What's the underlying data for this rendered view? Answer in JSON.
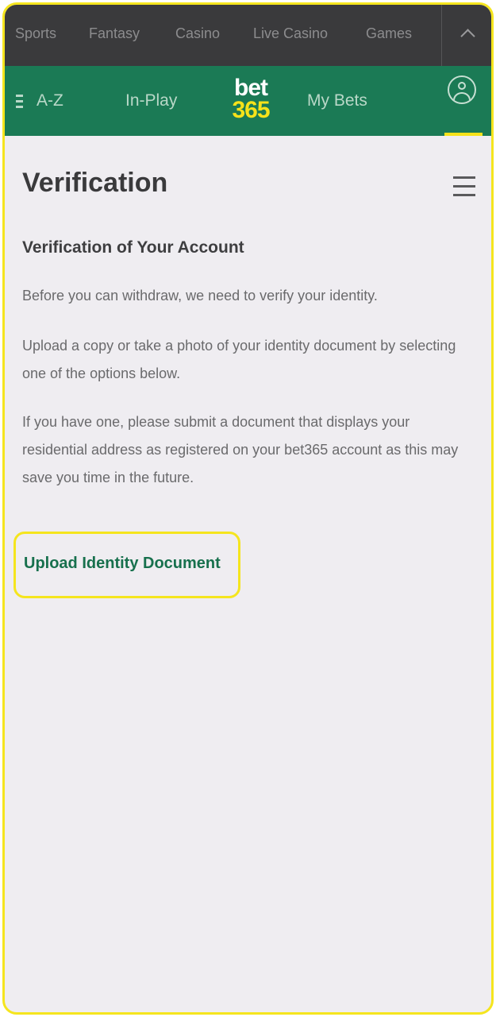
{
  "top_categories": [
    "Sports",
    "Fantasy",
    "Casino",
    "Live Casino",
    "Games"
  ],
  "nav": {
    "az_label": "A-Z",
    "inplay_label": "In-Play",
    "logo_top": "bet",
    "logo_bottom": "365",
    "mybets_label": "My Bets"
  },
  "page": {
    "title": "Verification",
    "section_title": "Verification of Your Account",
    "paragraphs": [
      "Before you can withdraw, we need to verify your identity.",
      "Upload a copy or take a photo of your identity document by selecting one of the options below.",
      "If you have one, please submit a document that displays your residential address as registered on your bet365 account as this may save you time in the future."
    ],
    "upload_label": "Upload Identity Document"
  },
  "icons": {
    "menu": "menu-icon",
    "user": "user-icon",
    "collapse": "chevron-up-icon",
    "az": "list-icon"
  },
  "colors": {
    "nav_green": "#1b7a55",
    "top_bar": "#3a3a3c",
    "accent_yellow": "#f6e21a",
    "link_green": "#17704d",
    "page_bg": "#efedf1"
  }
}
